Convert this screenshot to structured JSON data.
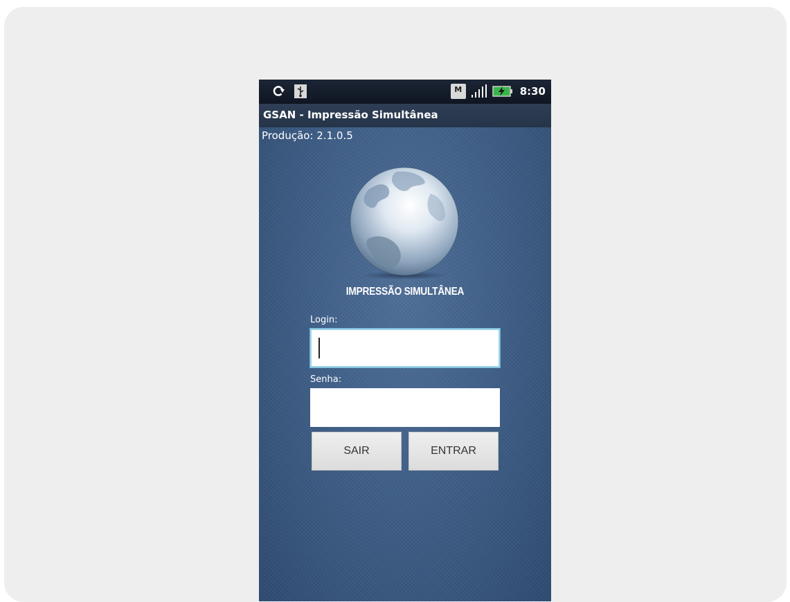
{
  "status_bar": {
    "left_icons": [
      "sync-icon",
      "usb-icon"
    ],
    "notification_icon_label": "M",
    "right_icons": [
      "notification-icon",
      "signal-icon",
      "battery-charging-icon"
    ],
    "time": "8:30"
  },
  "app": {
    "title": "GSAN - Impressão Simultânea",
    "version": "Produção: 2.1.0.5"
  },
  "logo": {
    "icon": "globe-icon",
    "text": "IMPRESSÃO SIMULTÂNEA"
  },
  "form": {
    "login_label": "Login:",
    "login_value": "",
    "password_label": "Senha:",
    "password_value": ""
  },
  "buttons": {
    "exit_label": "SAIR",
    "enter_label": "ENTRAR"
  },
  "colors": {
    "background": "#eeeeee",
    "app_background": "#3f5f88",
    "status_bar": "#0f1622",
    "title_bar": "#2a3a50",
    "input_focus": "#6cb9d8",
    "button": "#e4e4e4"
  }
}
